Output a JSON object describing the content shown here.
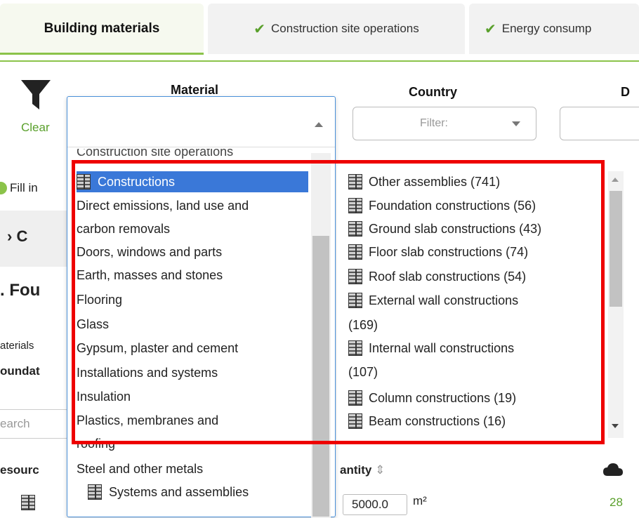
{
  "tabs": [
    {
      "label": "Building materials",
      "active": true
    },
    {
      "label": "Construction site operations",
      "done": true
    },
    {
      "label": "Energy consump",
      "done": true
    }
  ],
  "filter": {
    "clear_label": "Clear",
    "columns": {
      "material": "Material",
      "country": "Country",
      "cut": "D"
    },
    "country_placeholder": "Filter:"
  },
  "background": {
    "fill_in": "Fill in",
    "section_prefix": "C",
    "foundation_prefix": ". Fou",
    "materials_prefix": "aterials",
    "foundat_prefix": "oundat",
    "search_prefix": "earch",
    "resource_prefix": "esourc",
    "quantity_label": "antity",
    "quantity_value": "5000.0",
    "unit": "m²",
    "right_value": "28"
  },
  "material_dropdown": {
    "partial_top": "Construction site operations",
    "selected": "Constructions",
    "items": [
      "Direct emissions, land use and",
      "carbon removals",
      "Doors, windows and parts",
      "Earth, masses and stones",
      "Flooring",
      "Glass",
      "Gypsum, plaster and cement",
      "Installations and systems",
      "Insulation",
      "Plastics, membranes and",
      "roofing",
      "Steel and other metals",
      "Systems and assemblies"
    ]
  },
  "sub_options": [
    "Other assemblies (741)",
    "Foundation constructions (56)",
    "Ground slab constructions (43)",
    "Floor slab constructions (74)",
    "Roof slab constructions (54)",
    "External wall constructions",
    "(169)",
    "Internal wall constructions",
    "(107)",
    "Column constructions (19)",
    "Beam constructions (16)"
  ],
  "colors": {
    "accent": "#8bc34a",
    "check": "#5aa02c",
    "selected": "#3a78d8",
    "highlight": "#ee0000"
  },
  "icons": {
    "filter": "funnel-icon",
    "check": "checkmark-icon",
    "construction": "wall-block-icon"
  }
}
